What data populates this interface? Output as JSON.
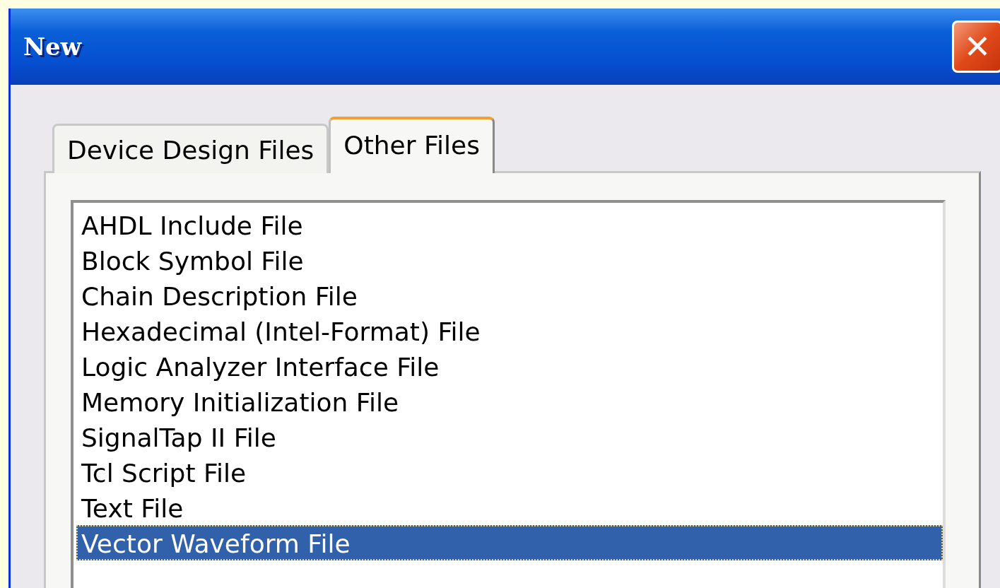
{
  "window": {
    "title": "New",
    "close_button": "✕"
  },
  "tabs": [
    {
      "label": "Device Design Files",
      "selected": false
    },
    {
      "label": "Other Files",
      "selected": true
    }
  ],
  "file_types": [
    {
      "label": "AHDL Include File",
      "selected": false
    },
    {
      "label": "Block Symbol File",
      "selected": false
    },
    {
      "label": "Chain Description File",
      "selected": false
    },
    {
      "label": "Hexadecimal (Intel-Format) File",
      "selected": false
    },
    {
      "label": "Logic Analyzer Interface File",
      "selected": false
    },
    {
      "label": "Memory Initialization File",
      "selected": false
    },
    {
      "label": "SignalTap II File",
      "selected": false
    },
    {
      "label": "Tcl Script File",
      "selected": false
    },
    {
      "label": "Text File",
      "selected": false
    },
    {
      "label": "Vector Waveform File",
      "selected": true
    }
  ]
}
